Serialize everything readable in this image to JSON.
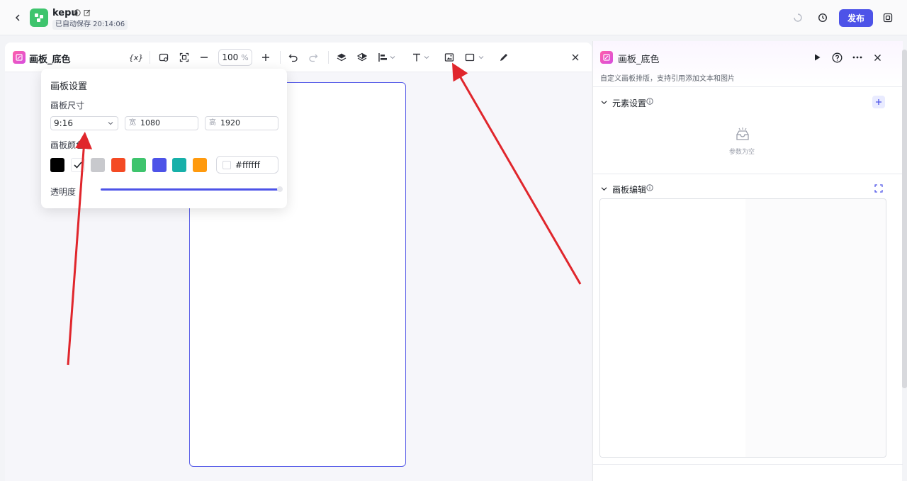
{
  "app": {
    "name": "kepu",
    "saved_status": "已自动保存 20:14:06",
    "publish_label": "发布",
    "icons": [
      "back-icon",
      "app-logo",
      "info-icon",
      "edit-icon",
      "loading-icon",
      "history-icon",
      "copy-icon"
    ]
  },
  "editor": {
    "title": "画板_底色",
    "variable_label": "{x}",
    "zoom": "100",
    "zoom_unit": "%",
    "toolbar_icons": [
      "variable-icon",
      "canvas-fit-icon",
      "fullscreen-icon",
      "zoom-out-icon",
      "zoom-in-icon",
      "undo-icon",
      "redo-icon",
      "layer-up-icon",
      "layer-icon",
      "align-icon",
      "text-icon",
      "image-icon",
      "rectangle-icon",
      "pen-icon",
      "close-icon"
    ]
  },
  "canvas_settings": {
    "title": "画板设置",
    "size_label": "画板尺寸",
    "ratio": "9:16",
    "width_prefix": "宽",
    "width": "1080",
    "height_prefix": "高",
    "height": "1920",
    "color_label": "画板颜色",
    "swatches": [
      "#000000",
      "#ffffff",
      "#c8c9cd",
      "#f44a24",
      "#3ec46d",
      "#4d53e8",
      "#17b0a9",
      "#ff9a0e"
    ],
    "selected_swatch": "#ffffff",
    "hex": "#ffffff",
    "opacity_label": "透明度",
    "opacity": 1.0
  },
  "right_panel": {
    "title": "画板_底色",
    "description": "自定义画板排版，支持引用添加文本和图片",
    "element_settings": "元素设置",
    "empty_text": "参数为空",
    "canvas_edit": "画板编辑"
  },
  "colors": {
    "accent": "#4d53e8",
    "annotation_arrow": "#e0262c"
  }
}
